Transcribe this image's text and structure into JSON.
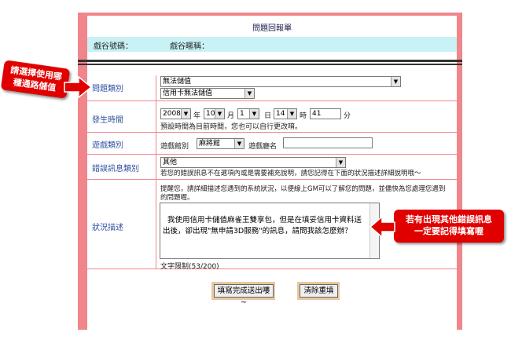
{
  "form": {
    "title": "問題回報單",
    "game_id_label": "戲谷號碼：",
    "game_nick_label": "戲谷暱稱："
  },
  "rows": {
    "category": {
      "label": "問題類別",
      "select1": "無法儲值",
      "select2": "信用卡無法儲值"
    },
    "time": {
      "label": "發生時間",
      "year": "2008",
      "year_unit": "年",
      "month": "10",
      "month_unit": "月",
      "day": "1",
      "day_unit": "日",
      "hour": "14",
      "hour_unit": "時",
      "minute": "41",
      "minute_unit": "分",
      "hint": "預設時間為目前時間，您也可以自行更改唷。"
    },
    "game_type": {
      "label": "遊戲類別",
      "hall_label": "遊戲館別",
      "hall_value": "麻將館",
      "name_label": "遊戲廳名",
      "name_value": ""
    },
    "error": {
      "label": "錯誤訊息類別",
      "select": "其他",
      "hint": "若您的錯誤訊息不在選項內或是需要補充說明，請您記得在下面的狀況描述詳細說明哦～"
    },
    "description": {
      "label": "狀況描述",
      "hint_line1": "提醒您，請詳細描述您遇到的系統狀況，以便線上GM可以了解您的問題，並儘快為您處理您遇到",
      "hint_line2": "的問題喔。",
      "text": "我使用信用卡儲值麻雀王雙享包，但是在填妥信用卡資料送出後，卻出現\"無申請3D服務\"的訊息，請問我該怎麼辦？",
      "limit": "文字限制(53/200)"
    }
  },
  "buttons": {
    "submit": "填寫完成送出嘍~",
    "reset": "清除重填"
  },
  "annotations": {
    "left_line1": "請選擇使用哪",
    "left_line2": "種通路儲值",
    "right_line1": "若有出現其他錯誤訊息",
    "right_line2": "一定要記得填寫喔"
  },
  "colors": {
    "frame": "#f0868c",
    "header_bar": "#c9f2f6",
    "label_text": "#3050a0",
    "callout": "#e00000"
  },
  "icons": {
    "dropdown": "chevron-down-icon",
    "callout_arrow": "arrow-icon"
  }
}
